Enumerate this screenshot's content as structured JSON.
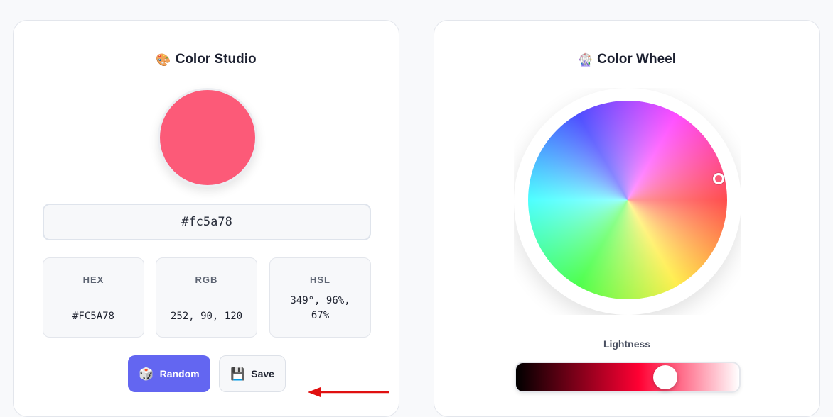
{
  "studio": {
    "title_icon": "🎨",
    "title": "Color Studio",
    "hex_input_value": "#fc5a78",
    "swatch_color": "#fc5a78",
    "values": {
      "hex": {
        "label": "HEX",
        "value": "#FC5A78"
      },
      "rgb": {
        "label": "RGB",
        "value": "252, 90, 120"
      },
      "hsl": {
        "label": "HSL",
        "value": "349°, 96%, 67%"
      }
    },
    "buttons": {
      "random_icon": "🎲",
      "random_label": "Random",
      "save_icon": "💾",
      "save_label": "Save"
    }
  },
  "wheel": {
    "title_icon": "🎡",
    "title": "Color Wheel",
    "lightness_label": "Lightness",
    "lightness_value": 0.67,
    "accent_color": "#fc5a78"
  },
  "annotation": {
    "arrow_color": "#e01010"
  },
  "colors": {
    "primary": "#6366f1",
    "page_bg": "#f8f9fb",
    "card_bg": "#ffffff"
  }
}
